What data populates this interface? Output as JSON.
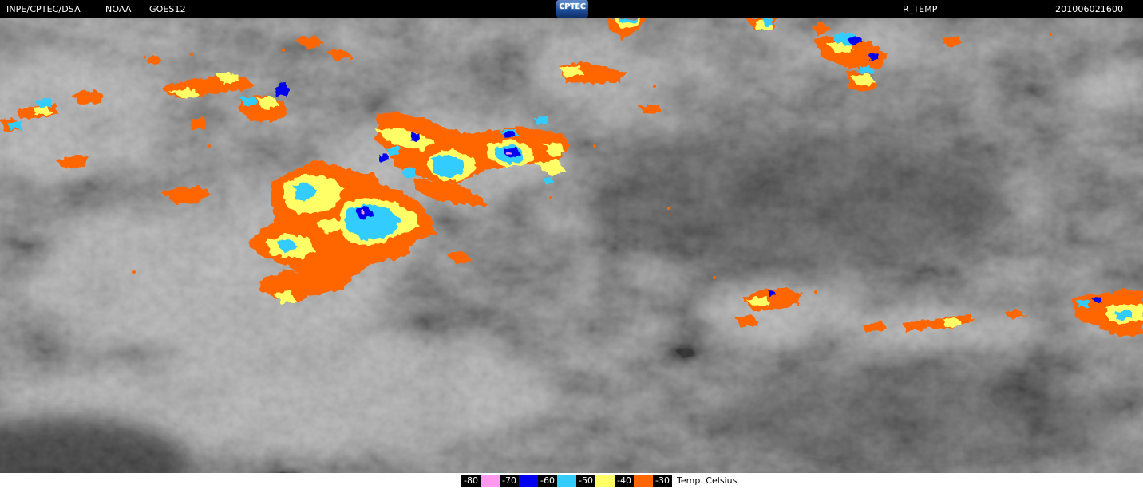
{
  "header": {
    "org": "INPE/CPTEC/DSA",
    "agency": "NOAA",
    "satellite": "GOES12",
    "logo_text": "CPTEC",
    "product": "R_TEMP",
    "timestamp": "201006021600"
  },
  "legend": {
    "items": [
      {
        "label": "-80",
        "color": "#ff99ee"
      },
      {
        "label": "-70",
        "color": "#0000ee"
      },
      {
        "label": "-60",
        "color": "#33ccff"
      },
      {
        "label": "-50",
        "color": "#ffff66"
      },
      {
        "label": "-40",
        "color": "#ff6600"
      },
      {
        "label": "-30"
      }
    ],
    "unit": "Temp. Celsius"
  }
}
